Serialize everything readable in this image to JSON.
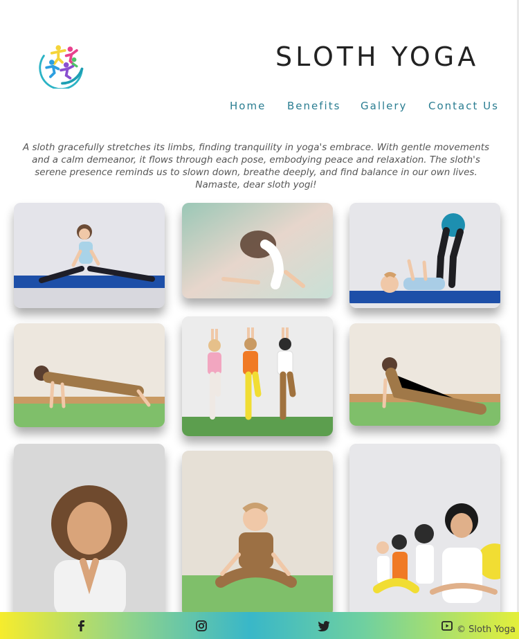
{
  "brand": {
    "title": "SLOTH YOGA",
    "logo_icon": "yoga-people-logo"
  },
  "nav": {
    "items": [
      {
        "label": "Home"
      },
      {
        "label": "Benefits"
      },
      {
        "label": "Gallery"
      },
      {
        "label": "Contact Us"
      }
    ]
  },
  "intro": {
    "text": "A sloth gracefully stretches its limbs, finding tranquility in yoga's embrace. With gentle movements and a calm demeanor, it flows through each pose, embodying peace and relaxation. The sloth's serene presence reminds us to slown down, breathe deeply, and find balance in our own lives. Namaste, dear sloth yogi!"
  },
  "gallery": {
    "photos": [
      {
        "alt": "girl-splits-on-blue-mat"
      },
      {
        "alt": "girl-backbend-soft-light"
      },
      {
        "alt": "child-lying-with-ball"
      },
      {
        "alt": "boy-plank-on-green-mat"
      },
      {
        "alt": "three-kids-tree-pose"
      },
      {
        "alt": "boy-cobra-pose"
      },
      {
        "alt": "girl-praying-hands"
      },
      {
        "alt": "boy-lotus-pose"
      },
      {
        "alt": "kids-meditating-in-row"
      }
    ]
  },
  "footer": {
    "icons": [
      "facebook-icon",
      "instagram-icon",
      "twitter-icon",
      "youtube-icon"
    ],
    "copyright": "© Sloth Yoga"
  },
  "colors": {
    "nav": "#2a7d91",
    "footer_gradient": [
      "#f6ec2d",
      "#39b7c8",
      "#e4ef3a"
    ]
  }
}
